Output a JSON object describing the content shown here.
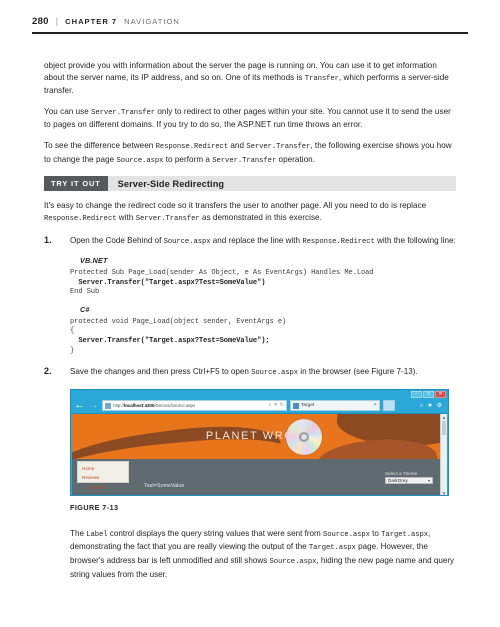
{
  "running_head": {
    "page_number": "280",
    "separator": "|",
    "chapter": "CHAPTER 7",
    "section": "NAVIGATION"
  },
  "paragraphs": {
    "p1_a": "object provide you with information about the server the page is running on. You can use it to get information about the server name, its IP address, and so on. One of its methods is ",
    "p1_code": "Transfer",
    "p1_b": ", which performs a server-side transfer.",
    "p2_a": "You can use ",
    "p2_code": "Server.Transfer",
    "p2_b": " only to redirect to other pages within your site. You cannot use it to send the user to pages on different domains. If you try to do so, the ASP.NET run time throws an error.",
    "p3_a": "To see the difference between ",
    "p3_code1": "Response.Redirect",
    "p3_b": " and ",
    "p3_code2": "Server.Transfer",
    "p3_c": ", the following exercise shows you how to change the page ",
    "p3_code3": "Source.aspx",
    "p3_d": " to perform a ",
    "p3_code4": "Server.Transfer",
    "p3_e": " operation."
  },
  "try_it_out": {
    "badge": "TRY IT OUT",
    "title": "Server-Side Redirecting",
    "intro_a": "It's easy to change the redirect code so it transfers the user to another page. All you need to do is replace ",
    "intro_code1": "Response.Redirect",
    "intro_b": " with ",
    "intro_code2": "Server.Transfer",
    "intro_c": " as demonstrated in this exercise."
  },
  "steps": [
    {
      "number": "1.",
      "text_a": "Open the Code Behind of ",
      "code1": "Source.aspx",
      "text_b": " and replace the line with ",
      "code2": "Response.Redirect",
      "text_c": " with the following line:"
    },
    {
      "number": "2.",
      "text_a": "Save the changes and then press Ctrl+F5 to open ",
      "code1": "Source.aspx",
      "text_b": " in the browser (see Figure 7-13)."
    }
  ],
  "code_blocks": [
    {
      "language": "VB.NET",
      "line1": "Protected Sub Page_Load(sender As Object, e As EventArgs) Handles Me.Load",
      "line2_bold": "  Server.Transfer(\"Target.aspx?Test=SomeValue\")",
      "line3": "End Sub"
    },
    {
      "language": "C#",
      "line1": "protected void Page_Load(object sender, EventArgs e)",
      "line2": "{",
      "line3_bold": "  Server.Transfer(\"Target.aspx?Test=SomeValue\");",
      "line4": "}"
    }
  ],
  "figure": {
    "caption": "FIGURE 7-13",
    "browser": {
      "window_buttons": {
        "minimize": "–",
        "maximize": "□",
        "close": "✕"
      },
      "back_arrow": "←",
      "forward_arrow": "→",
      "address_url_prefix": "http://",
      "address_url_host": "localhost:4200",
      "address_url_path": "/Demos/Source.aspx",
      "address_icons": {
        "search": "⌕",
        "refresh": "↻",
        "stop": "✕"
      },
      "tab_label": "Target",
      "tab_close": "✕",
      "toolbar_icons": {
        "home": "⌂",
        "favorites": "★",
        "settings": "⚙"
      },
      "scrollbar": {
        "up": "▲",
        "down": "▼"
      }
    },
    "site": {
      "title": "PLANET WROX",
      "menu": [
        "Home",
        "Reviews"
      ],
      "menu_sub": "By Genre",
      "label_output": "Test=SomeValue",
      "theme_label": "Select a Theme",
      "theme_value": "DarkGrey",
      "theme_arrow": "▾"
    }
  },
  "closing": {
    "a": "The ",
    "code1": "Label",
    "b": " control displays the query string values that were sent from ",
    "code2": "Source.aspx",
    "c": " to ",
    "code3": "Target.aspx",
    "d": ", demonstrating the fact that you are really viewing the output of the ",
    "code4": "Target.aspx",
    "e": " page. However, the browser's address bar is left unmodified and still shows ",
    "code5": "Source.aspx",
    "f": ", hiding the new page name and query string values from the user."
  }
}
